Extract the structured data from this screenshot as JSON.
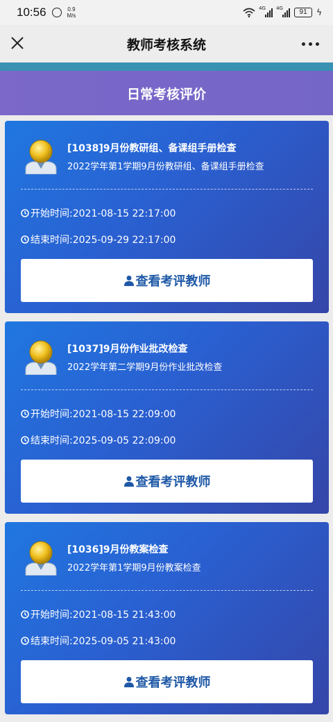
{
  "status_bar": {
    "time": "10:56",
    "net_speed_value": "0.9",
    "net_speed_unit": "M/s",
    "signal_label_1": "4G",
    "signal_label_2": "4G",
    "battery": "91"
  },
  "nav": {
    "title": "教师考核系统",
    "close_icon": "close-icon",
    "more_icon": "more-icon"
  },
  "header": {
    "title": "日常考核评价"
  },
  "colors": {
    "card_gradient_start": "#2077e0",
    "card_gradient_end": "#3546a8",
    "header_bg": "#7466c7",
    "teal_strip": "#3a92b2",
    "button_text": "#1e58a6"
  },
  "cards": [
    {
      "title": "[1038]9月份教研组、备课组手册检查",
      "subtitle": "2022学年第1学期9月份教研组、备课组手册检查",
      "start": "开始时间:2021-08-15 22:17:00",
      "end": "结束时间:2025-09-29 22:17:00",
      "button": "查看考评教师"
    },
    {
      "title": "[1037]9月份作业批改检查",
      "subtitle": "2022学年第二学期9月份作业批改检查",
      "start": "开始时间:2021-08-15 22:09:00",
      "end": "结束时间:2025-09-05 22:09:00",
      "button": "查看考评教师"
    },
    {
      "title": "[1036]9月份教案检查",
      "subtitle": "2022学年第1学期9月份教案检查",
      "start": "开始时间:2021-08-15 21:43:00",
      "end": "结束时间:2025-09-05 21:43:00",
      "button": "查看考评教师"
    }
  ]
}
